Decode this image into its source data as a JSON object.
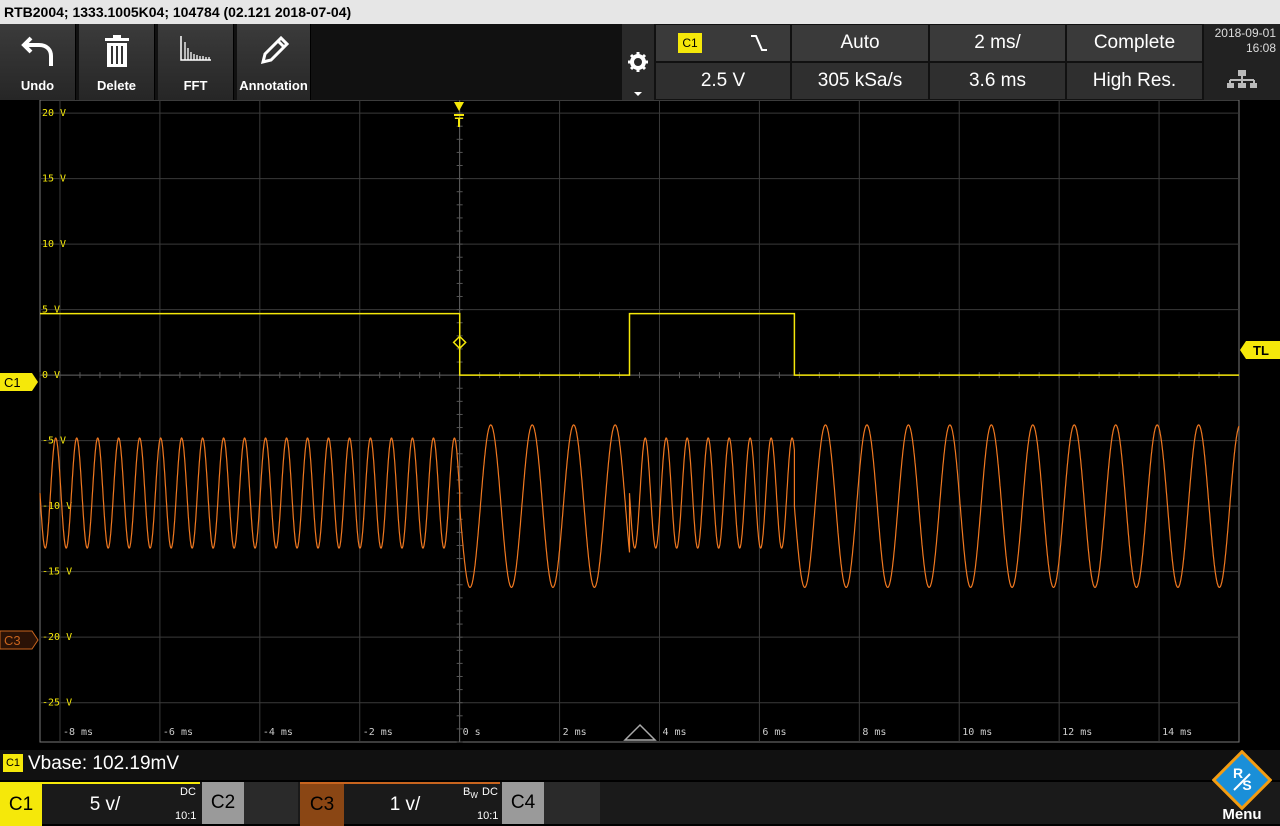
{
  "title_bar": {
    "text": "RTB2004; 1333.1005K04; 104784 (02.121 2018-07-04)"
  },
  "toolbar": {
    "undo_label": "Undo",
    "delete_label": "Delete",
    "fft_label": "FFT",
    "annotation_label": "Annotation"
  },
  "trigger": {
    "source": "C1",
    "slope_icon": "falling-edge-icon",
    "level": "2.5 V",
    "mode": "Auto"
  },
  "acquisition": {
    "sample_rate": "305 kSa/s",
    "timebase": "2 ms/",
    "position": "3.6 ms",
    "status": "Complete",
    "mode": "High Res."
  },
  "datetime": {
    "date": "2018-09-01",
    "time": "16:08"
  },
  "axes": {
    "y_labels": [
      "20 V",
      "15 V",
      "10 V",
      "5 V",
      "0 V",
      "-5 V",
      "-10 V",
      "-15 V",
      "-20 V",
      "-25 V"
    ],
    "x_labels": [
      "-8 ms",
      "-6 ms",
      "-4 ms",
      "-2 ms",
      "0 s",
      "2 ms",
      "4 ms",
      "6 ms",
      "8 ms",
      "10 ms",
      "12 ms",
      "14 ms"
    ]
  },
  "markers": {
    "trigger_marker": "T",
    "trigger_level": "TL",
    "ch1": "C1",
    "ch3": "C3"
  },
  "info": {
    "channel": "C1",
    "text": "Vbase: 102.19mV"
  },
  "channels": [
    {
      "name": "C1",
      "scale": "5 v/",
      "coupling": "DC",
      "probe": "10:1",
      "color": "#f5e80a"
    },
    {
      "name": "C2",
      "scale": "",
      "coupling": "",
      "probe": "",
      "color": "#9a9a9a"
    },
    {
      "name": "C3",
      "scale": "1 v/",
      "bw": "B",
      "bw_sub": "W",
      "coupling": "DC",
      "probe": "10:1",
      "color": "#c8641e"
    },
    {
      "name": "C4",
      "scale": "",
      "coupling": "",
      "probe": "",
      "color": "#9a9a9a"
    }
  ],
  "menu_label": "Menu",
  "chart_data": {
    "type": "line",
    "x_unit": "ms",
    "x_range": [
      -8.4,
      15.6
    ],
    "y_range": [
      -28,
      21
    ],
    "series": [
      {
        "name": "C1",
        "color": "#f5e80a",
        "segments": [
          [
            -8.4,
            4.7
          ],
          [
            0,
            4.7
          ],
          [
            0,
            0
          ],
          [
            3.4,
            0
          ],
          [
            3.4,
            4.7
          ],
          [
            6.7,
            4.7
          ],
          [
            6.7,
            0
          ],
          [
            15.6,
            0
          ]
        ]
      },
      {
        "name": "C3",
        "color": "#f07820",
        "pieces": [
          {
            "x0": -8.4,
            "x1": 0,
            "period_ms": 0.42,
            "center": -9.0,
            "amplitude": 4.2
          },
          {
            "x0": 0,
            "x1": 3.4,
            "period_ms": 0.83,
            "center": -10.0,
            "amplitude": 6.2
          },
          {
            "x0": 3.4,
            "x1": 6.7,
            "period_ms": 0.42,
            "center": -9.0,
            "amplitude": 4.2
          },
          {
            "x0": 6.7,
            "x1": 15.6,
            "period_ms": 0.83,
            "center": -10.0,
            "amplitude": 6.2
          }
        ]
      }
    ]
  }
}
